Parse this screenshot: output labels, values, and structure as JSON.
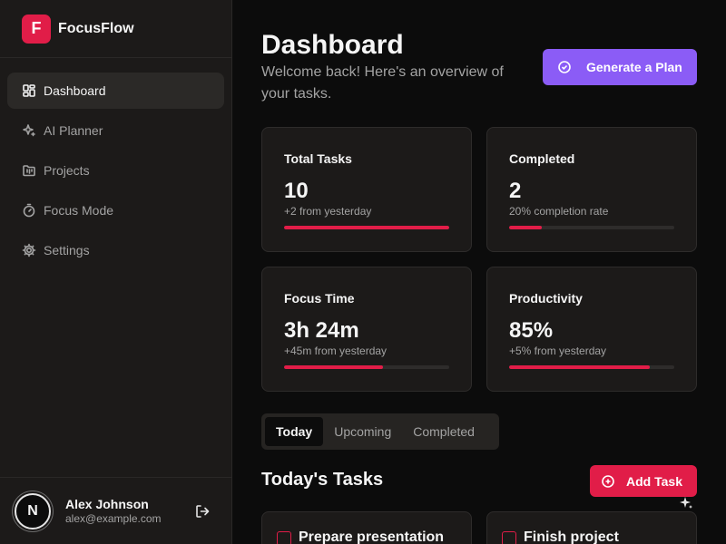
{
  "app": {
    "logo_letter": "F",
    "name": "FocusFlow",
    "accent": "#e11d48"
  },
  "sidebar": {
    "items": [
      {
        "label": "Dashboard",
        "icon": "dashboard-icon",
        "active": true
      },
      {
        "label": "AI Planner",
        "icon": "sparkles-icon",
        "active": false
      },
      {
        "label": "Projects",
        "icon": "folder-kanban-icon",
        "active": false
      },
      {
        "label": "Focus Mode",
        "icon": "timer-icon",
        "active": false
      },
      {
        "label": "Settings",
        "icon": "gear-icon",
        "active": false
      }
    ]
  },
  "user": {
    "initial": "N",
    "name": "Alex Johnson",
    "email": "alex@example.com"
  },
  "header": {
    "title": "Dashboard",
    "subtitle": "Welcome back! Here's an overview of your tasks.",
    "generate_label": "Generate a Plan",
    "generate_color": "#8b5cf6"
  },
  "stats": [
    {
      "label": "Total Tasks",
      "value": "10",
      "sub": "+2 from yesterday",
      "progress": 1.0
    },
    {
      "label": "Completed",
      "value": "2",
      "sub": "20% completion rate",
      "progress": 0.2
    },
    {
      "label": "Focus Time",
      "value": "3h 24m",
      "sub": "+45m from yesterday",
      "progress": 0.6
    },
    {
      "label": "Productivity",
      "value": "85%",
      "sub": "+5% from yesterday",
      "progress": 0.85
    }
  ],
  "tabs": [
    {
      "label": "Today",
      "active": true
    },
    {
      "label": "Upcoming",
      "active": false
    },
    {
      "label": "Completed",
      "active": false
    }
  ],
  "tasks_section": {
    "title": "Today's Tasks",
    "add_label": "Add Task"
  },
  "tasks": [
    {
      "title": "Prepare presentation"
    },
    {
      "title": "Finish project"
    }
  ]
}
